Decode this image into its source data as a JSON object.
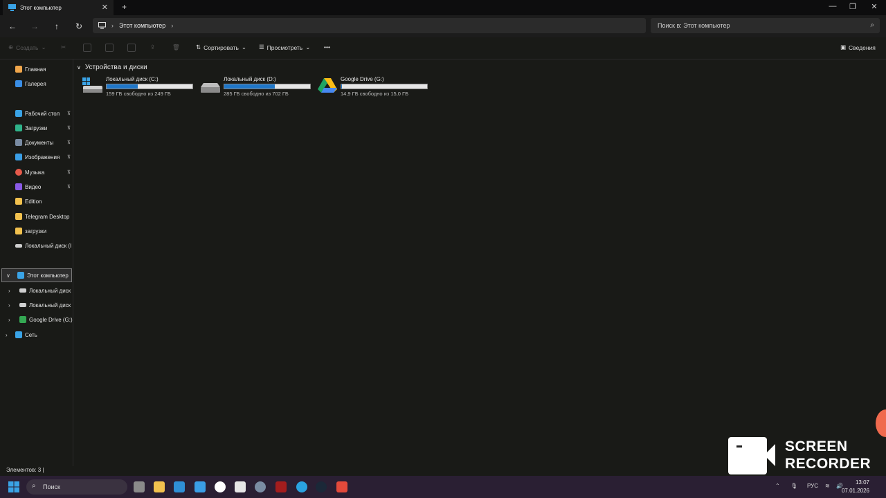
{
  "window": {
    "tab_title": "Этот компьютер",
    "tab_close": "✕",
    "new_tab": "+",
    "minimize": "—",
    "maximize": "❐",
    "close": "✕"
  },
  "nav": {
    "back": "←",
    "forward": "→",
    "up": "↑",
    "refresh": "↻"
  },
  "address": {
    "crumb": "Этот компьютер",
    "chevron": "›"
  },
  "search": {
    "placeholder": "Поиск в: Этот компьютер",
    "icon": "⌕"
  },
  "toolbar": {
    "create": "Создать",
    "sort": "Сортировать",
    "view": "Просмотреть",
    "more": "•••",
    "details": "Сведения"
  },
  "sidebar": {
    "items": [
      {
        "label": "Главная",
        "icon": "home-icon",
        "color": "#f0a64b"
      },
      {
        "label": "Галерея",
        "icon": "gallery-icon",
        "color": "#3a8ee6"
      },
      {
        "label": "Рабочий стол",
        "icon": "desktop-icon",
        "color": "#3aa3e6",
        "pinned": true
      },
      {
        "label": "Загрузки",
        "icon": "download-icon",
        "color": "#2fb38a",
        "pinned": true
      },
      {
        "label": "Документы",
        "icon": "documents-icon",
        "color": "#7a8ca3",
        "pinned": true
      },
      {
        "label": "Изображения",
        "icon": "pictures-icon",
        "color": "#3a9ee6",
        "pinned": true
      },
      {
        "label": "Музыка",
        "icon": "music-icon",
        "color": "#e65a4b",
        "pinned": true
      },
      {
        "label": "Видео",
        "icon": "video-icon",
        "color": "#8a5ae6",
        "pinned": true
      },
      {
        "label": "Edition",
        "icon": "folder-icon",
        "color": "#f2c14e"
      },
      {
        "label": "Telegram Desktop",
        "icon": "folder-icon",
        "color": "#f2c14e"
      },
      {
        "label": "загрузки",
        "icon": "folder-icon",
        "color": "#f2c14e"
      },
      {
        "label": "Локальный диск (I",
        "icon": "drive-icon",
        "color": "#cfcfcf"
      },
      {
        "label": "Этот компьютер",
        "icon": "computer-icon",
        "color": "#3aa3e6"
      },
      {
        "label": "Локальный диск",
        "icon": "drive-icon",
        "color": "#cfcfcf"
      },
      {
        "label": "Локальный диск",
        "icon": "drive-icon",
        "color": "#cfcfcf"
      },
      {
        "label": "Google Drive (G:)",
        "icon": "google-drive-icon",
        "color": "#34a853"
      },
      {
        "label": "Сеть",
        "icon": "network-icon",
        "color": "#3aa3e6"
      }
    ],
    "pin": "📌"
  },
  "main": {
    "group_title": "Устройства и диски",
    "drives": [
      {
        "name": "Локальный диск (C:)",
        "free": "159 ГБ свободно из 249 ГБ",
        "used_fraction": 0.36
      },
      {
        "name": "Локальный диск (D:)",
        "free": "285 ГБ свободно из 702 ГБ",
        "used_fraction": 0.59
      },
      {
        "name": "Google Drive (G:)",
        "free": "14,9 ГБ свободно из 15,0 ГБ",
        "used_fraction": 0.01
      }
    ]
  },
  "status": {
    "items_count": "Элементов: 3 |"
  },
  "taskbar": {
    "search": "Поиск",
    "lang": "РУС",
    "time": "13:07",
    "date": "07.01.2026"
  },
  "overlay": {
    "line1": "SCREEN",
    "line2": "RECORDER"
  }
}
